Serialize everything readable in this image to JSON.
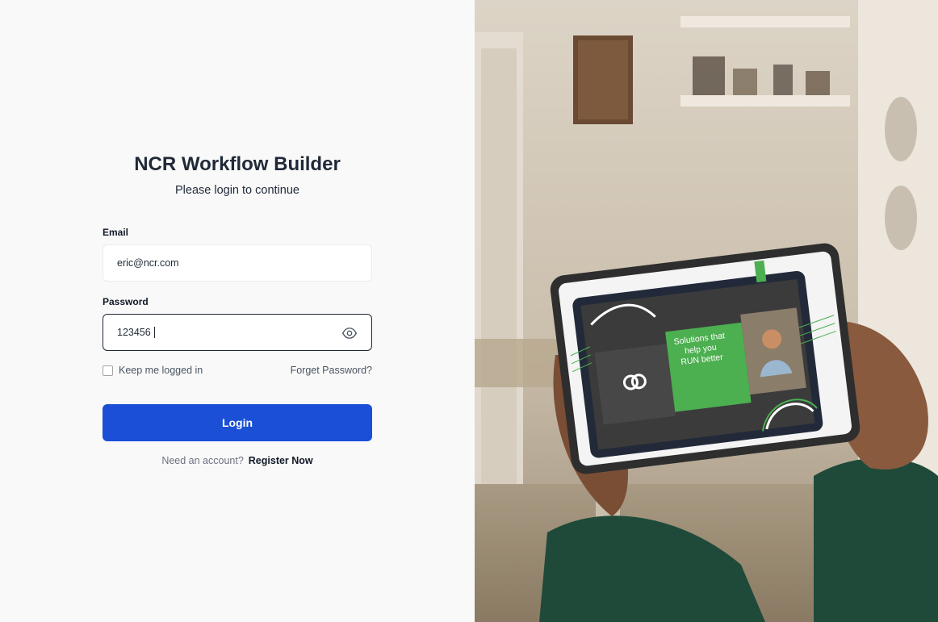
{
  "app": {
    "title": "NCR Workflow Builder",
    "subtitle": "Please login to continue"
  },
  "form": {
    "email_label": "Email",
    "email_value": "eric@ncr.com",
    "password_label": "Password",
    "password_value": "123456",
    "remember_label": "Keep me logged in",
    "remember_checked": false,
    "forgot_label": "Forget Password?",
    "login_label": "Login",
    "register_prompt": "Need an account?",
    "register_link": "Register Now"
  },
  "hero": {
    "tablet_tagline": "Solutions that help you RUN better",
    "accent_green": "#4caf50"
  },
  "colors": {
    "primary": "#1a4fd6",
    "text": "#1f2937",
    "background": "#f9f9f9"
  }
}
